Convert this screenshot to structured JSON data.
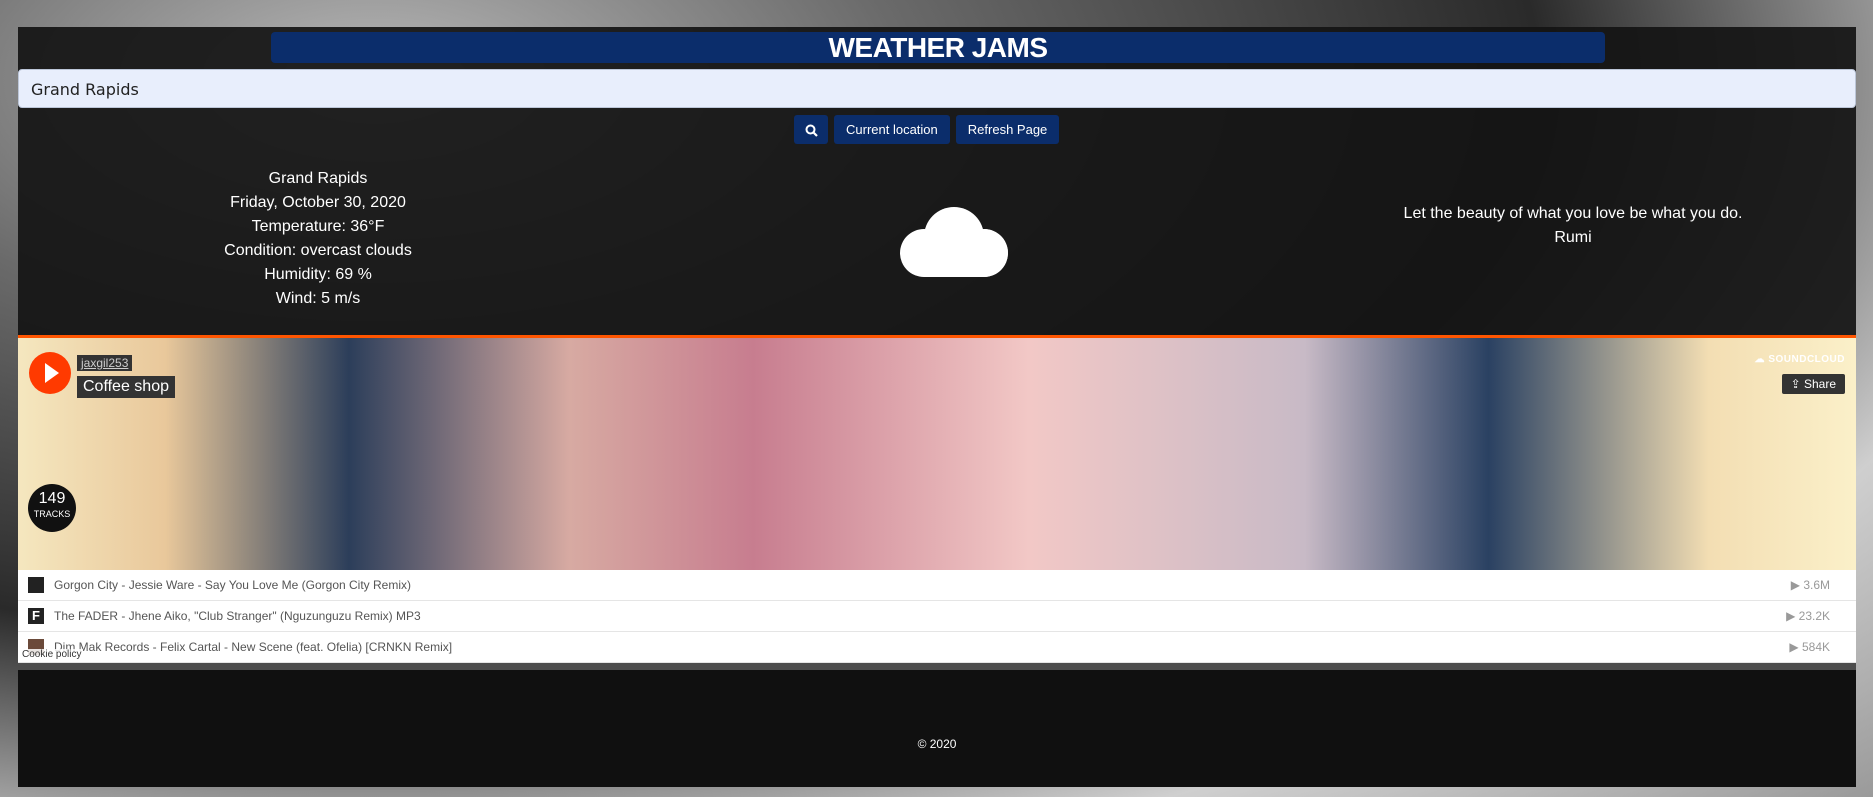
{
  "header": {
    "title": "WEATHER JAMS"
  },
  "search": {
    "value": "Grand Rapids"
  },
  "buttons": {
    "current_location": "Current location",
    "refresh": "Refresh Page"
  },
  "weather": {
    "city": "Grand Rapids",
    "date": "Friday, October 30, 2020",
    "temperature": "Temperature: 36°F",
    "condition": "Condition: overcast clouds",
    "humidity": "Humidity: 69 %",
    "wind": "Wind: 5 m/s",
    "icon": "cloud-icon"
  },
  "quote": {
    "text": "Let the beauty of what you love be what you do.",
    "author": "Rumi"
  },
  "player": {
    "user": "jaxgil253",
    "playlist": "Coffee shop",
    "brand": "SOUNDCLOUD",
    "share_label": "Share",
    "tracks_count": "149",
    "tracks_label": "TRACKS",
    "tracks": [
      {
        "title": "Gorgon City - Jessie Ware - Say You Love Me (Gorgon City Remix)",
        "plays": "▶ 3.6M"
      },
      {
        "title": "The FADER - Jhene Aiko, \"Club Stranger\" (Nguzunguzu Remix) MP3",
        "plays": "▶ 23.2K"
      },
      {
        "title": "Dim Mak Records - Felix Cartal - New Scene (feat. Ofelia) [CRNKN Remix]",
        "plays": "▶ 584K"
      }
    ],
    "cookie_policy": "Cookie policy"
  },
  "footer": {
    "copyright": "© 2020"
  },
  "colors": {
    "accent": "#0b2d6b",
    "soundcloud_orange": "#ff5500"
  }
}
